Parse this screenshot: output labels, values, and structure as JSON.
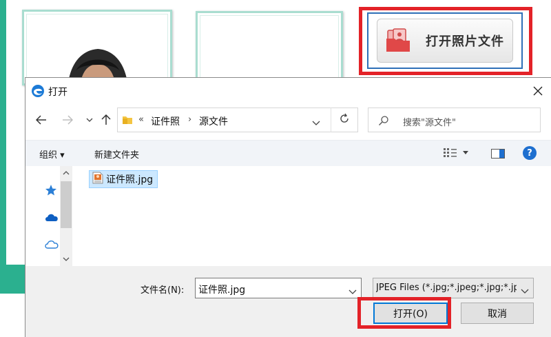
{
  "background_app": {
    "open_photo_button": {
      "label": "打开照片文件",
      "icon": "photo-folder-icon"
    },
    "accent_color": "#2bb08f",
    "highlight_color": "#e32228"
  },
  "dialog": {
    "title": "打开",
    "app_icon": "edge-browser-icon",
    "address": {
      "overflow": "«",
      "crumbs": [
        "证件照",
        "源文件"
      ],
      "separator": "›"
    },
    "search": {
      "placeholder": "搜索\"源文件\""
    },
    "toolbar": {
      "organize": "组织 ▾",
      "new_folder": "新建文件夹",
      "help": "?"
    },
    "nav_pane": {
      "items": [
        "quick-access-icon",
        "onedrive-icon",
        "cloud-icon"
      ]
    },
    "files": [
      {
        "name": "证件照.jpg",
        "icon": "jpg-file-icon",
        "selected": true
      }
    ],
    "filename_label": "文件名(N):",
    "filename_value": "证件照.jpg",
    "filetype_value": "JPEG Files (*.jpg;*.jpeg;*.jpg;*.jpeg)",
    "open_button": "打开(O)",
    "cancel_button": "取消"
  }
}
